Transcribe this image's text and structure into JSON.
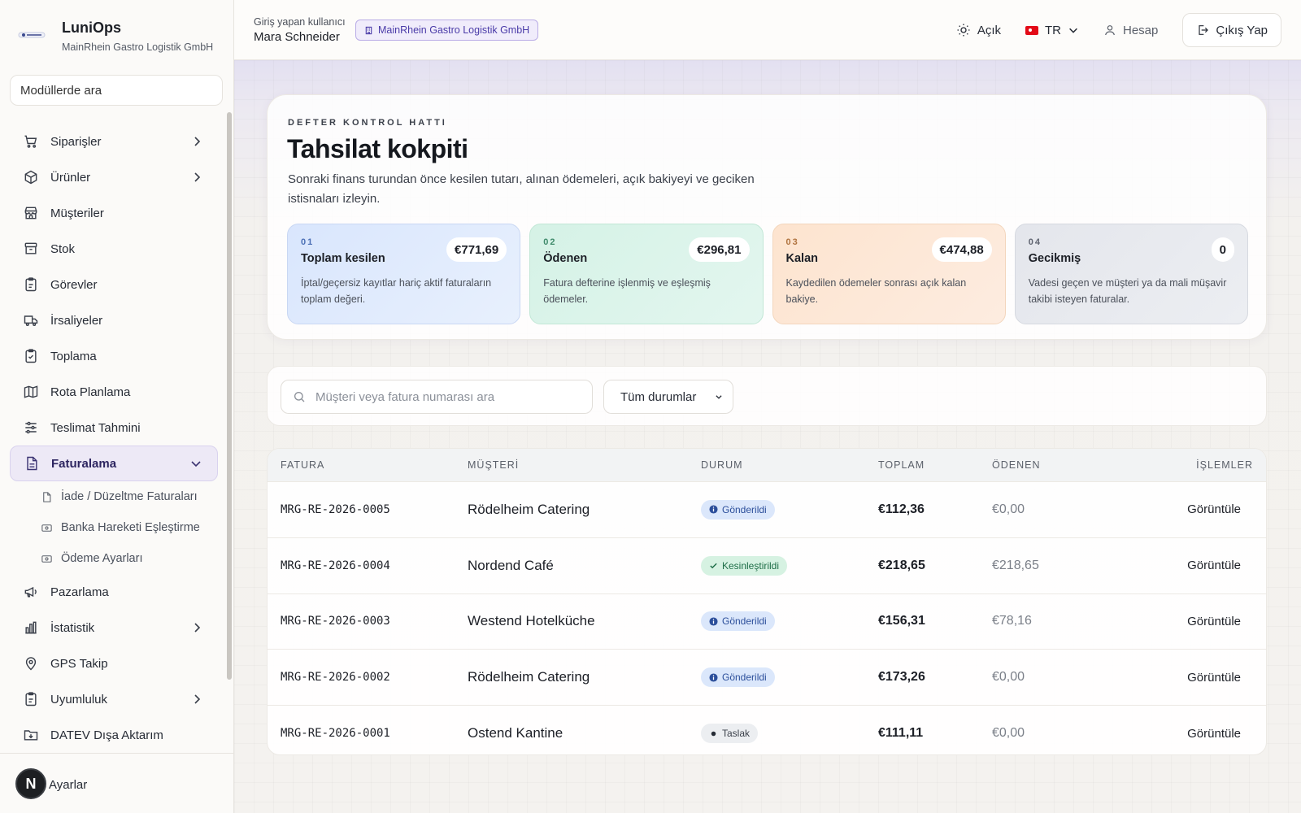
{
  "app": {
    "name": "LuniOps",
    "company": "MainRhein Gastro Logistik GmbH"
  },
  "sidebar": {
    "search_value": "Modüllerde ara",
    "items": [
      {
        "label": "Siparişler",
        "icon": "cart-icon",
        "chevron": true
      },
      {
        "label": "Ürünler",
        "icon": "box-icon",
        "chevron": true
      },
      {
        "label": "Müşteriler",
        "icon": "store-icon",
        "chevron": false
      },
      {
        "label": "Stok",
        "icon": "archive-icon",
        "chevron": false
      },
      {
        "label": "Görevler",
        "icon": "clipboard-icon",
        "chevron": false
      },
      {
        "label": "İrsaliyeler",
        "icon": "truck-icon",
        "chevron": false
      },
      {
        "label": "Toplama",
        "icon": "clipboard-check-icon",
        "chevron": false
      },
      {
        "label": "Rota Planlama",
        "icon": "map-icon",
        "chevron": false
      },
      {
        "label": "Teslimat Tahmini",
        "icon": "sliders-icon",
        "chevron": false
      },
      {
        "label": "Faturalama",
        "icon": "file-icon",
        "expanded": true
      },
      {
        "label": "Pazarlama",
        "icon": "megaphone-icon",
        "chevron": false
      },
      {
        "label": "İstatistik",
        "icon": "bar-chart-icon",
        "chevron": true
      },
      {
        "label": "GPS Takip",
        "icon": "map-pin-icon",
        "chevron": false
      },
      {
        "label": "Uyumluluk",
        "icon": "clipboard-icon",
        "chevron": true
      },
      {
        "label": "DATEV Dışa Aktarım",
        "icon": "download-folder-icon",
        "chevron": false
      }
    ],
    "sub_items": [
      {
        "label": "İade / Düzeltme Faturaları",
        "icon": "file-icon"
      },
      {
        "label": "Banka Hareketi Eşleştirme",
        "icon": "banknote-icon"
      },
      {
        "label": "Ödeme Ayarları",
        "icon": "banknote-icon"
      }
    ],
    "settings_label": "Ayarlar",
    "avatar_letter": "N"
  },
  "topbar": {
    "user_caption": "Giriş yapan kullanıcı",
    "user_name": "Mara Schneider",
    "tenant": "MainRhein Gastro Logistik GmbH",
    "theme_label": "Açık",
    "language": "TR",
    "account_label": "Hesap",
    "logout_label": "Çıkış Yap"
  },
  "hero": {
    "eyebrow": "DEFTER KONTROL HATTI",
    "title": "Tahsilat kokpiti",
    "description": "Sonraki finans turundan önce kesilen tutarı, alınan ödemeleri, açık bakiyeyi ve geciken istisnaları izleyin.",
    "kpis": [
      {
        "num": "01",
        "label": "Toplam kesilen",
        "value": "€771,69",
        "desc": "İptal/geçersiz kayıtlar hariç aktif faturaların toplam değeri."
      },
      {
        "num": "02",
        "label": "Ödenen",
        "value": "€296,81",
        "desc": "Fatura defterine işlenmiş ve eşleşmiş ödemeler."
      },
      {
        "num": "03",
        "label": "Kalan",
        "value": "€474,88",
        "desc": "Kaydedilen ödemeler sonrası açık kalan bakiye."
      },
      {
        "num": "04",
        "label": "Gecikmiş",
        "value": "0",
        "desc": "Vadesi geçen ve müşteri ya da mali müşavir takibi isteyen faturalar."
      }
    ]
  },
  "filters": {
    "search_placeholder": "Müşteri veya fatura numarası ara",
    "status_selected": "Tüm durumlar"
  },
  "table": {
    "headers": [
      "FATURA",
      "MÜŞTERİ",
      "DURUM",
      "TOPLAM",
      "ÖDENEN",
      "İŞLEMLER"
    ],
    "rows": [
      {
        "invoice": "MRG-RE-2026-0005",
        "customer": "Rödelheim Catering",
        "status": "Gönderildi",
        "status_type": "sent",
        "total": "€112,36",
        "paid": "€0,00",
        "action": "Görüntüle"
      },
      {
        "invoice": "MRG-RE-2026-0004",
        "customer": "Nordend Café",
        "status": "Kesinleştirildi",
        "status_type": "final",
        "total": "€218,65",
        "paid": "€218,65",
        "action": "Görüntüle"
      },
      {
        "invoice": "MRG-RE-2026-0003",
        "customer": "Westend Hotelküche",
        "status": "Gönderildi",
        "status_type": "sent",
        "total": "€156,31",
        "paid": "€78,16",
        "action": "Görüntüle"
      },
      {
        "invoice": "MRG-RE-2026-0002",
        "customer": "Rödelheim Catering",
        "status": "Gönderildi",
        "status_type": "sent",
        "total": "€173,26",
        "paid": "€0,00",
        "action": "Görüntüle"
      },
      {
        "invoice": "MRG-RE-2026-0001",
        "customer": "Ostend Kantine",
        "status": "Taslak",
        "status_type": "draft",
        "total": "€111,11",
        "paid": "€0,00",
        "action": "Görüntüle"
      }
    ]
  }
}
